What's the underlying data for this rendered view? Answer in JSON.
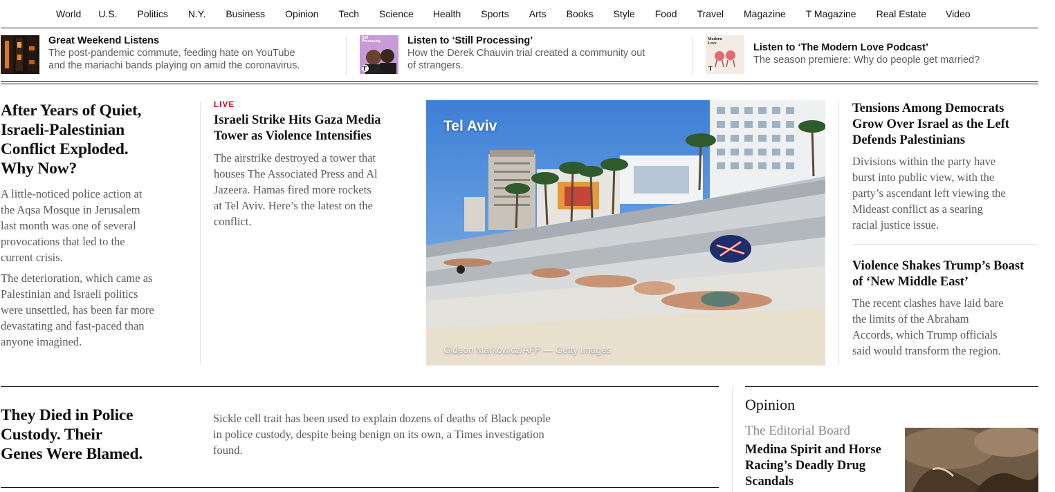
{
  "nav": {
    "items": [
      "World",
      "U.S.",
      "Politics",
      "N.Y.",
      "Business",
      "Opinion",
      "Tech",
      "Science",
      "Health",
      "Sports",
      "Arts",
      "Books",
      "Style",
      "Food",
      "Travel",
      "Magazine",
      "T Magazine",
      "Real Estate",
      "Video"
    ]
  },
  "podcasts": [
    {
      "title": "Great Weekend Listens",
      "desc_line1": "The post-pandemic commute, feeding hate on YouTube",
      "desc_line2": "and the mariachi bands playing on amid the coronavirus."
    },
    {
      "thumb_text": "Still Processing",
      "title": "Listen to ‘Still Processing’",
      "desc_line1": "How the Derek Chauvin trial created a community out",
      "desc_line2": "of strangers."
    },
    {
      "thumb_text": "Modern Love",
      "title": "Listen to ‘The Modern Love Podcast’",
      "desc_line1": "The season premiere: Why do people get married?"
    }
  ],
  "lead": {
    "headline_lines": [
      "After Years of Quiet,",
      "Israeli-Palestinian",
      "Conflict Exploded.",
      "Why Now?"
    ],
    "summary1_lines": [
      "A little-noticed police action at",
      "the Aqsa Mosque in Jerusalem",
      "last month was one of several",
      "provocations that led to the",
      "current crisis."
    ],
    "summary2_lines": [
      "The deterioration, which came as",
      "Palestinian and Israeli politics",
      "were unsettled, has been far more",
      "devastating and fast-paced than",
      "anyone imagined."
    ]
  },
  "live_story": {
    "kicker": "LIVE",
    "headline_lines": [
      "Israeli Strike Hits Gaza Media",
      "Tower as Violence Intensifies"
    ],
    "summary_lines": [
      "The airstrike destroyed a tower that",
      "houses The Associated Press and Al",
      "Jazeera. Hamas fired more rockets",
      "at Tel Aviv. Here’s the latest on the",
      "conflict."
    ]
  },
  "photo": {
    "label": "Tel Aviv",
    "credit": "Gideon Markowicz/AFP — Getty Images"
  },
  "right_stories": [
    {
      "headline_lines": [
        "Tensions Among Democrats",
        "Grow Over Israel as the Left",
        "Defends Palestinians"
      ],
      "summary_lines": [
        "Divisions within the party have",
        "burst into public view, with the",
        "party’s ascendant left viewing the",
        "Mideast conflict as a searing",
        "racial justice issue."
      ]
    },
    {
      "headline_lines": [
        "Violence Shakes Trump’s Boast",
        "of ‘New Middle East’"
      ],
      "summary_lines": [
        "The recent clashes have laid bare",
        "the limits of the Abraham",
        "Accords, which Trump officials",
        "said would transform the region."
      ]
    }
  ],
  "second": {
    "headline_lines": [
      "They Died in Police",
      "Custody. Their",
      "Genes Were Blamed."
    ],
    "summary_lines": [
      "Sickle cell trait has been used to explain dozens of deaths of Black people",
      "in police custody, despite being benign on its own, a Times investigation",
      "found."
    ]
  },
  "opinion": {
    "heading": "Opinion",
    "byline": "The Editorial Board",
    "headline_lines": [
      "Medina Spirit and Horse",
      "Racing’s Deadly Drug",
      "Scandals"
    ]
  }
}
